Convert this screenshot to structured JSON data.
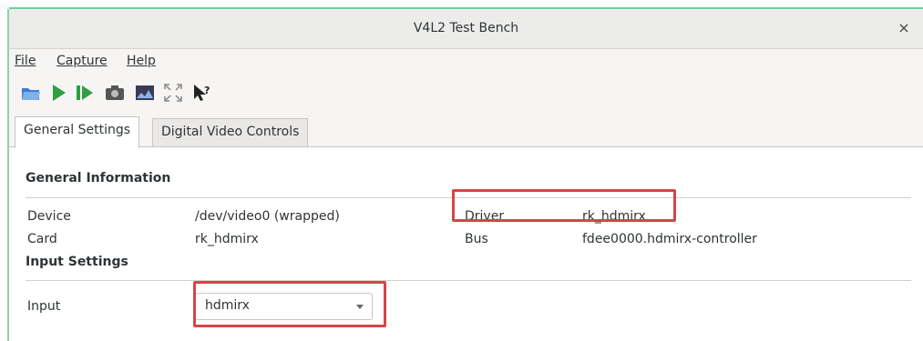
{
  "window": {
    "title": "V4L2 Test Bench"
  },
  "menu": [
    "File",
    "Capture",
    "Help"
  ],
  "toolbar": [
    {
      "icon": "open-device-icon"
    },
    {
      "icon": "start-capture-icon"
    },
    {
      "icon": "single-step-icon"
    },
    {
      "icon": "snapshot-icon"
    },
    {
      "icon": "capture-window-icon"
    },
    {
      "icon": "fullscreen-icon"
    },
    {
      "icon": "whats-this-icon"
    }
  ],
  "tabs": [
    "General Settings",
    "Digital Video Controls"
  ],
  "general_info": {
    "heading": "General Information",
    "device_label": "Device",
    "device_value": "/dev/video0 (wrapped)",
    "card_label": "Card",
    "card_value": "rk_hdmirx",
    "driver_label": "Driver",
    "driver_value": "rk_hdmirx",
    "bus_label": "Bus",
    "bus_value": "fdee0000.hdmirx-controller"
  },
  "input_settings": {
    "heading": "Input Settings",
    "input_label": "Input",
    "input_value": "hdmirx"
  },
  "colors": {
    "highlight": "#d64545",
    "accent_line": "#6fcf97"
  }
}
